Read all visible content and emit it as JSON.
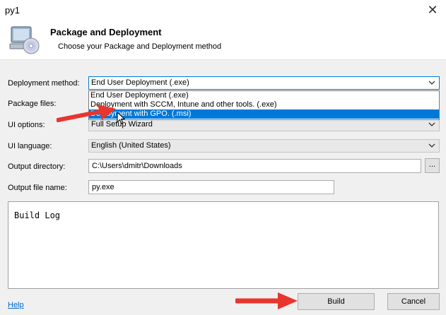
{
  "window": {
    "title": "py1",
    "close_glyph": "✕"
  },
  "header": {
    "title": "Package and Deployment",
    "subtitle": "Choose your Package and Deployment method",
    "icon": "computer-cd-icon"
  },
  "form": {
    "deployment_method": {
      "label": "Deployment method:",
      "value": "End User Deployment (.exe)"
    },
    "package_files": {
      "label": "Package files:"
    },
    "ui_options": {
      "label": "UI options:",
      "value": "Full Setup Wizard"
    },
    "ui_language": {
      "label": "UI language:",
      "value": "English (United States)"
    },
    "output_directory": {
      "label": "Output directory:",
      "value": "C:\\Users\\dmitr\\Downloads",
      "browse_label": "..."
    },
    "output_file_name": {
      "label": "Output file name:",
      "value": "py.exe"
    }
  },
  "dropdown": {
    "options": [
      "End User Deployment (.exe)",
      "Deployment with SCCM, Intune and other tools. (.exe)",
      "Deployment with GPO. (.msi)"
    ],
    "highlighted_index": 2
  },
  "build_log": {
    "text": "Build Log"
  },
  "footer": {
    "help_label": "Help",
    "build_label": "Build",
    "cancel_label": "Cancel"
  },
  "colors": {
    "accent": "#0078d7",
    "arrow": "#e8352e"
  }
}
